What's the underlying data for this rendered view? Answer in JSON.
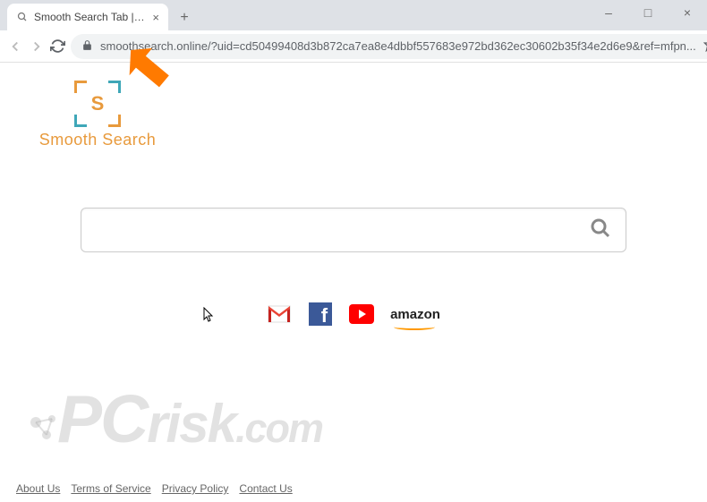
{
  "window": {
    "minimize": "–",
    "maximize": "□",
    "close": "×"
  },
  "tab": {
    "title": "Smooth Search Tab | Search"
  },
  "address": {
    "url": "smoothsearch.online/?uid=cd50499408d3b872ca7ea8e4dbbf557683e972bd362ec30602b35f34e2d6e9&ref=mfpn..."
  },
  "logo": {
    "letter": "S",
    "text": "Smooth Search"
  },
  "search": {
    "placeholder": ""
  },
  "quicklinks": {
    "amazon": "amazon"
  },
  "footer": {
    "about": "About Us",
    "terms": "Terms of Service",
    "privacy": "Privacy Policy",
    "contact": "Contact Us"
  },
  "watermark": {
    "text_part1": "PC",
    "text_part2": "risk",
    "text_part3": ".com"
  }
}
